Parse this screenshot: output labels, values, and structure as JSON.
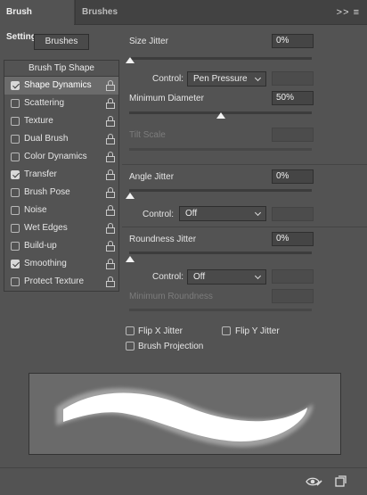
{
  "tabs": {
    "active": "Brush Settings",
    "inactive": "Brushes",
    "menu": ">> ≡"
  },
  "brushes_button": "Brushes",
  "sidebar": {
    "header": "Brush Tip Shape",
    "items": [
      {
        "label": "Shape Dynamics",
        "checked": true,
        "selected": true
      },
      {
        "label": "Scattering",
        "checked": false
      },
      {
        "label": "Texture",
        "checked": false
      },
      {
        "label": "Dual Brush",
        "checked": false
      },
      {
        "label": "Color Dynamics",
        "checked": false
      },
      {
        "label": "Transfer",
        "checked": true
      },
      {
        "label": "Brush Pose",
        "checked": false
      },
      {
        "label": "Noise",
        "checked": false
      },
      {
        "label": "Wet Edges",
        "checked": false
      },
      {
        "label": "Build-up",
        "checked": false
      },
      {
        "label": "Smoothing",
        "checked": true
      },
      {
        "label": "Protect Texture",
        "checked": false
      }
    ]
  },
  "size_jitter": {
    "label": "Size Jitter",
    "value": "0%",
    "slider_value": 0
  },
  "control1": {
    "label": "Control:",
    "value": "Pen Pressure"
  },
  "minimum_diameter": {
    "label": "Minimum Diameter",
    "value": "50%",
    "slider_value": 50
  },
  "tilt_scale": {
    "label": "Tilt Scale"
  },
  "angle_jitter": {
    "label": "Angle Jitter",
    "value": "0%",
    "slider_value": 0
  },
  "control2": {
    "label": "Control:",
    "value": "Off"
  },
  "roundness_jitter": {
    "label": "Roundness Jitter",
    "value": "0%",
    "slider_value": 0
  },
  "control3": {
    "label": "Control:",
    "value": "Off"
  },
  "minimum_roundness": {
    "label": "Minimum Roundness"
  },
  "flip_x": {
    "label": "Flip X Jitter",
    "checked": false
  },
  "flip_y": {
    "label": "Flip Y Jitter",
    "checked": false
  },
  "brush_projection": {
    "label": "Brush Projection",
    "checked": false
  },
  "icons": {
    "toggle_preview": "eye-brush-icon",
    "new_preset": "new-preset-icon"
  }
}
